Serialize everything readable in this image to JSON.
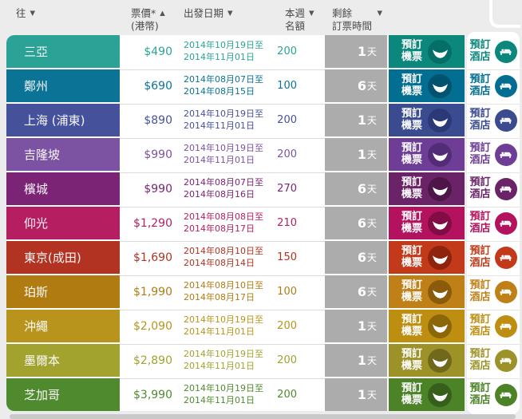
{
  "theme": {
    "page_bg": "#ECECEC",
    "white": "#FFFFFF",
    "header_text": "#4A4A4A",
    "cell_gray": "#ACACAC",
    "bar": "#C9C9C9"
  },
  "header": {
    "col_to": "往",
    "col_fare_line1": "票價*",
    "col_fare_line2": "(港幣)",
    "col_date": "出發日期",
    "col_quota_line1": "本週",
    "col_quota_line2": "名額",
    "col_remaining_line1": "剩餘",
    "col_remaining_line2": "訂票時間",
    "sort_asc_icon": "▲",
    "sort_desc_icon": "▼"
  },
  "buttons": {
    "book_flight": [
      "預訂",
      "機票"
    ],
    "book_hotel": [
      "預訂",
      "酒店"
    ]
  },
  "unit_day": "天",
  "rows": [
    {
      "dest": "三亞",
      "price": "$490",
      "date_from": "2014年10月19日至",
      "date_to": "2014年11月01日",
      "quota": "200",
      "days": "1",
      "colors": {
        "cell": "#2AA396",
        "button": "#0B877C",
        "icon": "#046F65"
      }
    },
    {
      "dest": "鄭州",
      "price": "$690",
      "date_from": "2014年08月07日至",
      "date_to": "2014年08月15日",
      "quota": "100",
      "days": "6",
      "colors": {
        "cell": "#0B7396",
        "button": "#026E91",
        "icon": "#00536F"
      }
    },
    {
      "dest": "上海 (浦東)",
      "price": "$890",
      "date_from": "2014年10月19日至",
      "date_to": "2014年11月01日",
      "quota": "200",
      "days": "1",
      "colors": {
        "cell": "#46519B",
        "button": "#3A4B90",
        "icon": "#2B3A77"
      }
    },
    {
      "dest": "吉隆坡",
      "price": "$990",
      "date_from": "2014年10月19日至",
      "date_to": "2014年11月01日",
      "quota": "200",
      "days": "1",
      "colors": {
        "cell": "#7C52A2",
        "button": "#6E3D96",
        "icon": "#532C77"
      }
    },
    {
      "dest": "檳城",
      "price": "$990",
      "date_from": "2014年08月07日至",
      "date_to": "2014年08月16日",
      "quota": "270",
      "days": "6",
      "colors": {
        "cell": "#7B2374",
        "button": "#6B2367",
        "icon": "#4E1549"
      }
    },
    {
      "dest": "仰光",
      "price": "$1,290",
      "date_from": "2014年08月08日至",
      "date_to": "2014年08月17日",
      "quota": "210",
      "days": "6",
      "colors": {
        "cell": "#B61E62",
        "button": "#B3125E",
        "icon": "#820D45"
      }
    },
    {
      "dest": "東京(成田)",
      "price": "$1,690",
      "date_from": "2014年08月10日至",
      "date_to": "2014年08月14日",
      "quota": "150",
      "days": "6",
      "colors": {
        "cell": "#B23321",
        "button": "#C23A19",
        "icon": "#8E230E"
      }
    },
    {
      "dest": "珀斯",
      "price": "$1,990",
      "date_from": "2014年08月10日至",
      "date_to": "2014年08月17日",
      "quota": "100",
      "days": "6",
      "colors": {
        "cell": "#B07C12",
        "button": "#C08018",
        "icon": "#8A5B0B"
      }
    },
    {
      "dest": "沖繩",
      "price": "$2,090",
      "date_from": "2014年10月19日至",
      "date_to": "2014年11月01日",
      "quota": "200",
      "days": "1",
      "colors": {
        "cell": "#B8941C",
        "button": "#BD8E10",
        "icon": "#8A680A"
      }
    },
    {
      "dest": "墨爾本",
      "price": "$2,890",
      "date_from": "2014年10月19日至",
      "date_to": "2014年11月01日",
      "quota": "200",
      "days": "1",
      "colors": {
        "cell": "#A2A22F",
        "button": "#9C9227",
        "icon": "#70691B"
      }
    },
    {
      "dest": "芝加哥",
      "price": "$3,990",
      "date_from": "2014年10月19日至",
      "date_to": "2014年11月01日",
      "quota": "200",
      "days": "1",
      "colors": {
        "cell": "#4F8A2E",
        "button": "#4C8326",
        "icon": "#365F1B"
      }
    }
  ]
}
